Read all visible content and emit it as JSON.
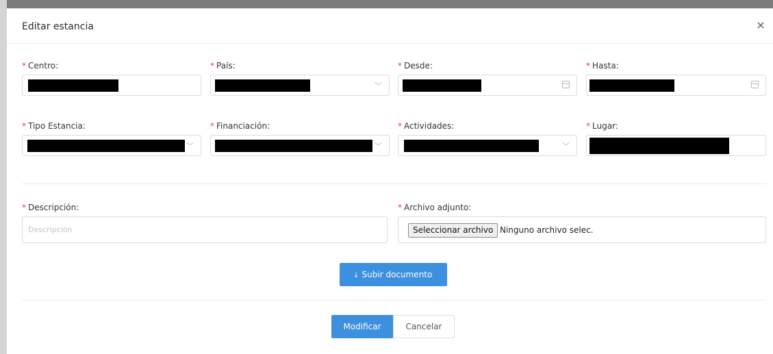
{
  "dialog": {
    "title": "Editar estancia",
    "close_glyph": "×"
  },
  "required_mark": "*",
  "fields": {
    "centro": {
      "label": "Centro:"
    },
    "pais": {
      "label": "País:"
    },
    "desde": {
      "label": "Desde:"
    },
    "hasta": {
      "label": "Hasta:"
    },
    "tipo_estancia": {
      "label": "Tipo Estancia:"
    },
    "financiacion": {
      "label": "Financiación:"
    },
    "actividades": {
      "label": "Actividades:"
    },
    "lugar": {
      "label": "Lugar:"
    },
    "descripcion": {
      "label": "Descripción:",
      "placeholder": "Descripción",
      "value": ""
    },
    "archivo": {
      "label": "Archivo adjunto:",
      "button_label": "Seleccionar archivo",
      "status": "Ninguno archivo selec."
    }
  },
  "icons": {
    "dropdown": "chevron-down-icon",
    "calendar": "calendar-icon",
    "upload": "upload-icon"
  },
  "upload_button": {
    "icon_glyph": "⤓",
    "label": "Subir documento"
  },
  "footer": {
    "primary_label": "Modificar",
    "cancel_label": "Cancelar"
  },
  "colors": {
    "primary": "#3d8fe0",
    "required": "#e4453a"
  }
}
